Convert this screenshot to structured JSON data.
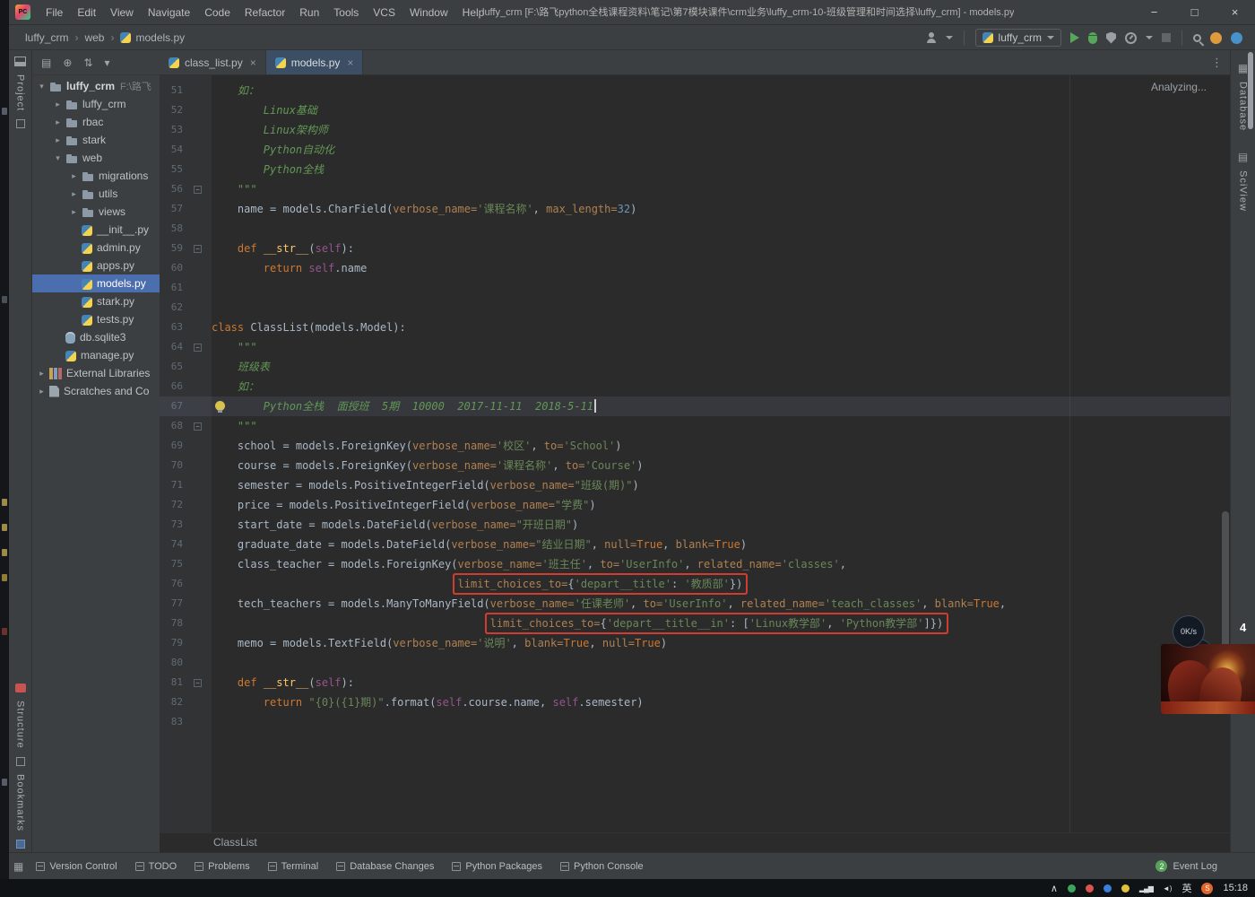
{
  "window": {
    "logo": "PC",
    "title": "luffy_crm [F:\\路飞python全栈课程资料\\笔记\\第7模块课件\\crm业务\\luffy_crm-10-班级管理和时间选择\\luffy_crm] - models.py",
    "menu": [
      "File",
      "Edit",
      "View",
      "Navigate",
      "Code",
      "Refactor",
      "Run",
      "Tools",
      "VCS",
      "Window",
      "Help"
    ],
    "controls": {
      "minimize": "−",
      "maximize": "□",
      "close": "×"
    }
  },
  "navbar": {
    "breadcrumbs": [
      "luffy_crm",
      "web",
      "models.py"
    ],
    "run_config": "luffy_crm"
  },
  "icons": {
    "fold": "−",
    "tab_close": "×",
    "tab_options": "⋮",
    "crumb_sep": "›",
    "tree_expanded": "▾",
    "tree_collapsed": "▸"
  },
  "stripes": {
    "left_top": "Project",
    "left_bottom": [
      "Structure",
      "Bookmarks"
    ],
    "right": [
      "Database",
      "SciView"
    ]
  },
  "project_panel": {
    "toolbar_icons": [
      "▤",
      "⊕",
      "⇅",
      "▾"
    ],
    "items": [
      {
        "label": "luffy_crm",
        "hint": "F:\\路飞",
        "level": 0,
        "icon": "folder",
        "arrow": "v",
        "bold": true
      },
      {
        "label": "luffy_crm",
        "level": 1,
        "icon": "folder",
        "arrow": ">"
      },
      {
        "label": "rbac",
        "level": 1,
        "icon": "folder",
        "arrow": ">"
      },
      {
        "label": "stark",
        "level": 1,
        "icon": "folder",
        "arrow": ">"
      },
      {
        "label": "web",
        "level": 1,
        "icon": "folder",
        "arrow": "v"
      },
      {
        "label": "migrations",
        "level": 2,
        "icon": "folder",
        "arrow": ">"
      },
      {
        "label": "utils",
        "level": 2,
        "icon": "folder",
        "arrow": ">"
      },
      {
        "label": "views",
        "level": 2,
        "icon": "folder",
        "arrow": ">"
      },
      {
        "label": "__init__.py",
        "level": 2,
        "icon": "pyf"
      },
      {
        "label": "admin.py",
        "level": 2,
        "icon": "pyf"
      },
      {
        "label": "apps.py",
        "level": 2,
        "icon": "pyf"
      },
      {
        "label": "models.py",
        "level": 2,
        "icon": "pyf",
        "selected": true
      },
      {
        "label": "stark.py",
        "level": 2,
        "icon": "pyf"
      },
      {
        "label": "tests.py",
        "level": 2,
        "icon": "pyf"
      },
      {
        "label": "db.sqlite3",
        "level": 1,
        "icon": "db"
      },
      {
        "label": "manage.py",
        "level": 1,
        "icon": "pyf"
      },
      {
        "label": "External Libraries",
        "level": 0,
        "icon": "lib",
        "arrow": ">"
      },
      {
        "label": "Scratches and Co",
        "level": 0,
        "icon": "scratch",
        "arrow": ">"
      }
    ]
  },
  "tabs": [
    {
      "label": "class_list.py",
      "active": false
    },
    {
      "label": "models.py",
      "active": true
    }
  ],
  "editor": {
    "analyzing": "Analyzing...",
    "breadcrumb": "ClassList",
    "lines": [
      {
        "n": 51,
        "seg": [
          [
            "c",
            "    如："
          ]
        ]
      },
      {
        "n": 52,
        "seg": [
          [
            "c",
            "        Linux基础"
          ]
        ]
      },
      {
        "n": 53,
        "seg": [
          [
            "c",
            "        Linux架构师"
          ]
        ]
      },
      {
        "n": 54,
        "seg": [
          [
            "c",
            "        Python自动化"
          ]
        ]
      },
      {
        "n": 55,
        "seg": [
          [
            "c",
            "        Python全栈"
          ]
        ]
      },
      {
        "n": 56,
        "fold": true,
        "seg": [
          [
            "c",
            "    \"\"\""
          ]
        ]
      },
      {
        "n": 57,
        "seg": [
          [
            "d",
            "    name = models.CharField("
          ],
          [
            "a",
            "verbose_name="
          ],
          [
            "s",
            "'课程名称'"
          ],
          [
            "d",
            ", "
          ],
          [
            "a",
            "max_length="
          ],
          [
            "n",
            "32"
          ],
          [
            "d",
            ")"
          ]
        ]
      },
      {
        "n": 58,
        "seg": []
      },
      {
        "n": 59,
        "fold": true,
        "seg": [
          [
            "d",
            "    "
          ],
          [
            "k",
            "def "
          ],
          [
            "m",
            "__str__"
          ],
          [
            "d",
            "("
          ],
          [
            "p",
            "self"
          ],
          [
            "d",
            "):"
          ]
        ]
      },
      {
        "n": 60,
        "seg": [
          [
            "d",
            "        "
          ],
          [
            "k",
            "return "
          ],
          [
            "p",
            "self"
          ],
          [
            "d",
            ".name"
          ]
        ]
      },
      {
        "n": 61,
        "seg": []
      },
      {
        "n": 62,
        "seg": []
      },
      {
        "n": 63,
        "seg": [
          [
            "k",
            "class "
          ],
          [
            "d",
            "ClassList(models.Model):"
          ]
        ]
      },
      {
        "n": 64,
        "fold": true,
        "seg": [
          [
            "c",
            "    \"\"\""
          ]
        ]
      },
      {
        "n": 65,
        "seg": [
          [
            "c",
            "    班级表"
          ]
        ]
      },
      {
        "n": 66,
        "seg": [
          [
            "c",
            "    如："
          ]
        ]
      },
      {
        "n": 67,
        "cur": true,
        "bulb": true,
        "caret": true,
        "seg": [
          [
            "c",
            "        Python全栈  面授班  5期  10000  2017-11-11  2018-5-11"
          ]
        ]
      },
      {
        "n": 68,
        "fold": true,
        "seg": [
          [
            "c",
            "    \"\"\""
          ]
        ]
      },
      {
        "n": 69,
        "seg": [
          [
            "d",
            "    school = models.ForeignKey("
          ],
          [
            "a",
            "verbose_name="
          ],
          [
            "s",
            "'校区'"
          ],
          [
            "d",
            ", "
          ],
          [
            "a",
            "to="
          ],
          [
            "s",
            "'School'"
          ],
          [
            "d",
            ")"
          ]
        ]
      },
      {
        "n": 70,
        "seg": [
          [
            "d",
            "    course = models.ForeignKey("
          ],
          [
            "a",
            "verbose_name="
          ],
          [
            "s",
            "'课程名称'"
          ],
          [
            "d",
            ", "
          ],
          [
            "a",
            "to="
          ],
          [
            "s",
            "'Course'"
          ],
          [
            "d",
            ")"
          ]
        ]
      },
      {
        "n": 71,
        "seg": [
          [
            "d",
            "    semester = models.PositiveIntegerField("
          ],
          [
            "a",
            "verbose_name="
          ],
          [
            "s",
            "\"班级(期)\""
          ],
          [
            "d",
            ")"
          ]
        ]
      },
      {
        "n": 72,
        "seg": [
          [
            "d",
            "    price = models.PositiveIntegerField("
          ],
          [
            "a",
            "verbose_name="
          ],
          [
            "s",
            "\"学费\""
          ],
          [
            "d",
            ")"
          ]
        ]
      },
      {
        "n": 73,
        "seg": [
          [
            "d",
            "    start_date = models.DateField("
          ],
          [
            "a",
            "verbose_name="
          ],
          [
            "s",
            "\"开班日期\""
          ],
          [
            "d",
            ")"
          ]
        ]
      },
      {
        "n": 74,
        "seg": [
          [
            "d",
            "    graduate_date = models.DateField("
          ],
          [
            "a",
            "verbose_name="
          ],
          [
            "s",
            "\"结业日期\""
          ],
          [
            "d",
            ", "
          ],
          [
            "a",
            "null="
          ],
          [
            "k",
            "True"
          ],
          [
            "d",
            ", "
          ],
          [
            "a",
            "blank="
          ],
          [
            "k",
            "True"
          ],
          [
            "d",
            ")"
          ]
        ]
      },
      {
        "n": 75,
        "seg": [
          [
            "d",
            "    class_teacher = models.ForeignKey("
          ],
          [
            "a",
            "verbose_name="
          ],
          [
            "s",
            "'班主任'"
          ],
          [
            "d",
            ", "
          ],
          [
            "a",
            "to="
          ],
          [
            "s",
            "'UserInfo'"
          ],
          [
            "d",
            ", "
          ],
          [
            "a",
            "related_name="
          ],
          [
            "s",
            "'classes'"
          ],
          [
            "d",
            ","
          ]
        ]
      },
      {
        "n": 76,
        "box": 1,
        "seg": [
          [
            "d",
            "                                      "
          ],
          [
            "a",
            "limit_choices_to="
          ],
          [
            "d",
            "{"
          ],
          [
            "s",
            "'depart__title'"
          ],
          [
            "d",
            ": "
          ],
          [
            "s",
            "'教质部'"
          ],
          [
            "d",
            "})"
          ]
        ]
      },
      {
        "n": 77,
        "seg": [
          [
            "d",
            "    tech_teachers = models.ManyToManyField("
          ],
          [
            "a",
            "verbose_name="
          ],
          [
            "s",
            "'任课老师'"
          ],
          [
            "d",
            ", "
          ],
          [
            "a",
            "to="
          ],
          [
            "s",
            "'UserInfo'"
          ],
          [
            "d",
            ", "
          ],
          [
            "a",
            "related_name="
          ],
          [
            "s",
            "'teach_classes'"
          ],
          [
            "d",
            ", "
          ],
          [
            "a",
            "blank="
          ],
          [
            "k",
            "True"
          ],
          [
            "d",
            ","
          ]
        ]
      },
      {
        "n": 78,
        "box": 1,
        "seg": [
          [
            "d",
            "                                           "
          ],
          [
            "a",
            "limit_choices_to="
          ],
          [
            "d",
            "{"
          ],
          [
            "s",
            "'depart__title__in'"
          ],
          [
            "d",
            ": ["
          ],
          [
            "s",
            "'Linux教学部'"
          ],
          [
            "d",
            ", "
          ],
          [
            "s",
            "'Python教学部'"
          ],
          [
            "d",
            "]})"
          ]
        ]
      },
      {
        "n": 79,
        "seg": [
          [
            "d",
            "    memo = models.TextField("
          ],
          [
            "a",
            "verbose_name="
          ],
          [
            "s",
            "'说明'"
          ],
          [
            "d",
            ", "
          ],
          [
            "a",
            "blank="
          ],
          [
            "k",
            "True"
          ],
          [
            "d",
            ", "
          ],
          [
            "a",
            "null="
          ],
          [
            "k",
            "True"
          ],
          [
            "d",
            ")"
          ]
        ]
      },
      {
        "n": 80,
        "seg": []
      },
      {
        "n": 81,
        "fold": true,
        "seg": [
          [
            "d",
            "    "
          ],
          [
            "k",
            "def "
          ],
          [
            "m",
            "__str__"
          ],
          [
            "d",
            "("
          ],
          [
            "p",
            "self"
          ],
          [
            "d",
            "):"
          ]
        ]
      },
      {
        "n": 82,
        "seg": [
          [
            "d",
            "        "
          ],
          [
            "k",
            "return "
          ],
          [
            "s",
            "\"{0}({1}期)\""
          ],
          [
            "d",
            ".format("
          ],
          [
            "p",
            "self"
          ],
          [
            "d",
            ".course.name, "
          ],
          [
            "p",
            "self"
          ],
          [
            "d",
            ".semester)"
          ]
        ]
      },
      {
        "n": 83,
        "seg": []
      }
    ]
  },
  "statusbar": {
    "items": [
      "Version Control",
      "TODO",
      "Problems",
      "Terminal",
      "Database Changes",
      "Python Packages",
      "Python Console"
    ],
    "event_log": "Event Log",
    "event_count": "2"
  },
  "taskbar": {
    "collapse": "∧",
    "net_icon": "▂▄▆",
    "vol_icon": "◄)",
    "lang": "英",
    "ime_badge": "S",
    "time": "15:18"
  },
  "overlay": {
    "speed_top": "0K/s",
    "speed_bottom": "0K/s",
    "badge": "4"
  },
  "colors": {
    "selection": "#4b6eaf",
    "annotation_red": "#cf3c30",
    "run_green": "#58a55c",
    "editor_bg": "#2b2b2b"
  }
}
